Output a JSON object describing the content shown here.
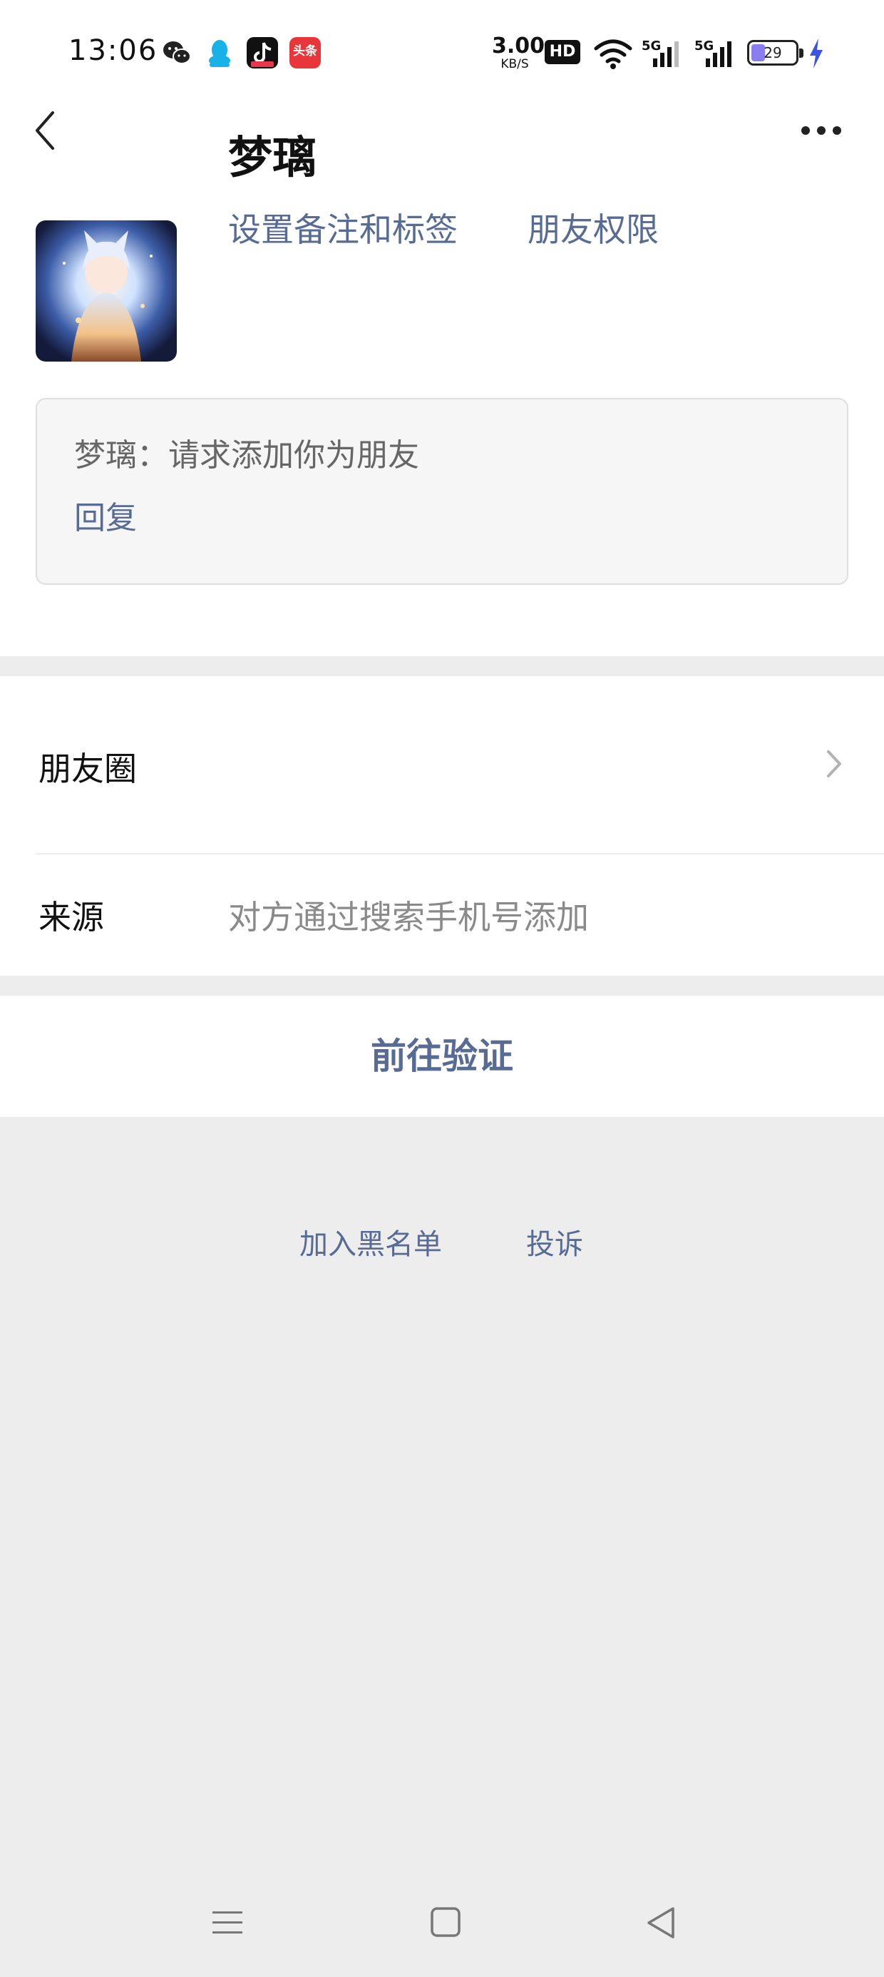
{
  "status_bar": {
    "time": "13:06",
    "net_speed_value": "3.00",
    "net_speed_unit": "KB/S",
    "hd_badge": "HD",
    "battery_level": "29",
    "app_icons": [
      "wechat-icon",
      "qq-icon",
      "douyin-icon",
      "toutiao-icon"
    ],
    "toutiao_label": "头条",
    "signal_labels": [
      "5G",
      "5G"
    ]
  },
  "header": {
    "back_icon": "chevron-left-icon",
    "more_icon": "more-horizontal-icon"
  },
  "profile": {
    "name": "梦璃",
    "remark_link": "设置备注和标签",
    "permission_link": "朋友权限"
  },
  "request": {
    "message": "梦璃：请求添加你为朋友",
    "reply_label": "回复"
  },
  "list": {
    "moments_label": "朋友圈",
    "source_label": "来源",
    "source_value": "对方通过搜索手机号添加"
  },
  "actions": {
    "verify_label": "前往验证",
    "blacklist_label": "加入黑名单",
    "complain_label": "投诉"
  },
  "navbar": {
    "icons": [
      "menu-icon",
      "home-square-icon",
      "back-triangle-icon"
    ]
  },
  "colors": {
    "link": "#576b95",
    "background": "#ededed",
    "card": "#ffffff"
  }
}
